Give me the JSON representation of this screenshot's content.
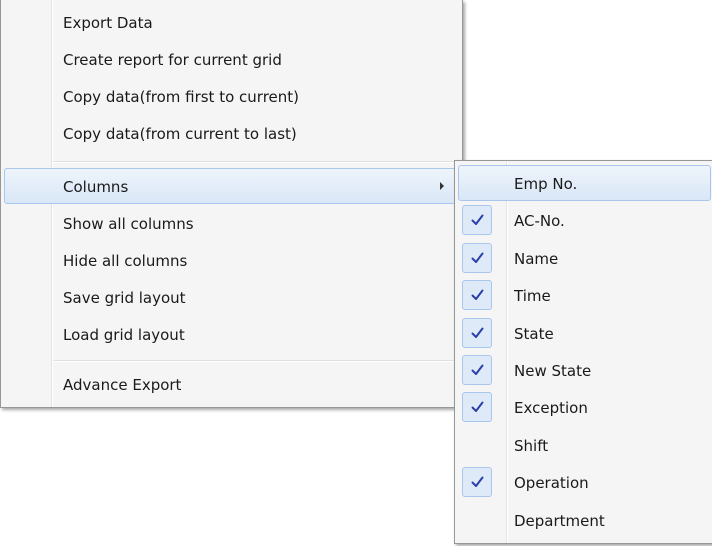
{
  "context_menu": {
    "group1": [
      "Export Data",
      "Create report for current grid",
      "Copy data(from first to current)",
      "Copy data(from current to last)"
    ],
    "columns_label": "Columns",
    "group2": [
      "Show all columns",
      "Hide all columns",
      "Save grid layout",
      "Load grid layout"
    ],
    "advance_export": "Advance Export"
  },
  "columns_submenu": {
    "items": [
      {
        "label": "Emp No.",
        "checked": false,
        "highlighted": true
      },
      {
        "label": "AC-No.",
        "checked": true
      },
      {
        "label": "Name",
        "checked": true
      },
      {
        "label": "Time",
        "checked": true
      },
      {
        "label": "State",
        "checked": true
      },
      {
        "label": "New State",
        "checked": true
      },
      {
        "label": "Exception",
        "checked": true
      },
      {
        "label": "Shift",
        "checked": false
      },
      {
        "label": "Operation",
        "checked": true
      },
      {
        "label": "Department",
        "checked": false
      }
    ]
  },
  "colors": {
    "highlight_border": "#a9c7ec",
    "checkmark": "#2b3fa8"
  },
  "icons": {
    "submenu_arrow": "chevron-right-icon",
    "check": "checkmark-icon"
  }
}
